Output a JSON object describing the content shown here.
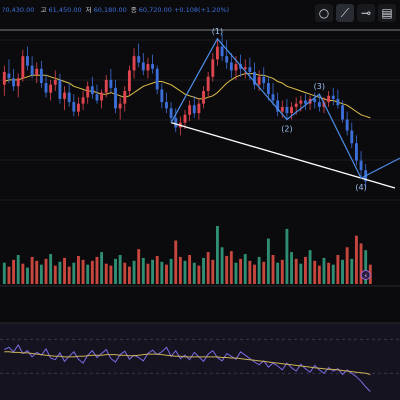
{
  "toolbar": {
    "items": [
      {
        "icon": "circle-tool-icon",
        "glyph": "○"
      },
      {
        "icon": "trendline-tool-icon",
        "glyph": "⟋"
      },
      {
        "icon": "horizontal-line-tool-icon",
        "glyph": "⊸"
      },
      {
        "icon": "more-tools-icon",
        "glyph": "▤"
      }
    ]
  },
  "chart_data": [
    {
      "type": "candlestick",
      "panel": "price",
      "header": {
        "left_text": "?0,430.00",
        "items": [
          {
            "key": "고",
            "value": "61,450.00"
          },
          {
            "key": "저",
            "value": "60,180.00"
          },
          {
            "key": "종",
            "value": "60,720.00 +0.108(+1.20%)"
          }
        ]
      },
      "up_color": "#e0464f",
      "down_color": "#3d6fd8",
      "candles": [
        {
          "o": 48,
          "h": 60,
          "l": 41,
          "c": 56
        },
        {
          "o": 55,
          "h": 64,
          "l": 49,
          "c": 52
        },
        {
          "o": 52,
          "h": 58,
          "l": 44,
          "c": 47
        },
        {
          "o": 47,
          "h": 55,
          "l": 40,
          "c": 52
        },
        {
          "o": 52,
          "h": 70,
          "l": 50,
          "c": 66
        },
        {
          "o": 66,
          "h": 72,
          "l": 57,
          "c": 60
        },
        {
          "o": 60,
          "h": 66,
          "l": 52,
          "c": 54
        },
        {
          "o": 54,
          "h": 62,
          "l": 49,
          "c": 58
        },
        {
          "o": 58,
          "h": 63,
          "l": 46,
          "c": 49
        },
        {
          "o": 49,
          "h": 54,
          "l": 40,
          "c": 43
        },
        {
          "o": 43,
          "h": 51,
          "l": 38,
          "c": 48
        },
        {
          "o": 48,
          "h": 57,
          "l": 44,
          "c": 51
        },
        {
          "o": 51,
          "h": 55,
          "l": 36,
          "c": 39
        },
        {
          "o": 39,
          "h": 47,
          "l": 32,
          "c": 43
        },
        {
          "o": 43,
          "h": 49,
          "l": 34,
          "c": 37
        },
        {
          "o": 37,
          "h": 42,
          "l": 28,
          "c": 31
        },
        {
          "o": 31,
          "h": 40,
          "l": 28,
          "c": 36
        },
        {
          "o": 36,
          "h": 44,
          "l": 32,
          "c": 40
        },
        {
          "o": 40,
          "h": 50,
          "l": 36,
          "c": 47
        },
        {
          "o": 47,
          "h": 53,
          "l": 39,
          "c": 42
        },
        {
          "o": 42,
          "h": 48,
          "l": 36,
          "c": 38
        },
        {
          "o": 38,
          "h": 45,
          "l": 33,
          "c": 43
        },
        {
          "o": 43,
          "h": 54,
          "l": 40,
          "c": 51
        },
        {
          "o": 51,
          "h": 58,
          "l": 43,
          "c": 46
        },
        {
          "o": 46,
          "h": 51,
          "l": 30,
          "c": 33
        },
        {
          "o": 33,
          "h": 40,
          "l": 26,
          "c": 36
        },
        {
          "o": 36,
          "h": 47,
          "l": 31,
          "c": 44
        },
        {
          "o": 44,
          "h": 60,
          "l": 41,
          "c": 57
        },
        {
          "o": 57,
          "h": 71,
          "l": 52,
          "c": 66
        },
        {
          "o": 66,
          "h": 74,
          "l": 59,
          "c": 62
        },
        {
          "o": 62,
          "h": 68,
          "l": 54,
          "c": 57
        },
        {
          "o": 57,
          "h": 65,
          "l": 52,
          "c": 61
        },
        {
          "o": 61,
          "h": 67,
          "l": 55,
          "c": 58
        },
        {
          "o": 58,
          "h": 60,
          "l": 42,
          "c": 45
        },
        {
          "o": 45,
          "h": 49,
          "l": 33,
          "c": 37
        },
        {
          "o": 37,
          "h": 43,
          "l": 30,
          "c": 33
        },
        {
          "o": 33,
          "h": 37,
          "l": 24,
          "c": 27
        },
        {
          "o": 27,
          "h": 33,
          "l": 18,
          "c": 21
        },
        {
          "o": 21,
          "h": 28,
          "l": 16,
          "c": 24
        },
        {
          "o": 24,
          "h": 32,
          "l": 20,
          "c": 29
        },
        {
          "o": 29,
          "h": 38,
          "l": 25,
          "c": 35
        },
        {
          "o": 35,
          "h": 41,
          "l": 27,
          "c": 30
        },
        {
          "o": 30,
          "h": 39,
          "l": 26,
          "c": 36
        },
        {
          "o": 36,
          "h": 47,
          "l": 33,
          "c": 44
        },
        {
          "o": 44,
          "h": 56,
          "l": 40,
          "c": 53
        },
        {
          "o": 53,
          "h": 68,
          "l": 50,
          "c": 64
        },
        {
          "o": 64,
          "h": 77,
          "l": 60,
          "c": 72
        },
        {
          "o": 72,
          "h": 80,
          "l": 63,
          "c": 66
        },
        {
          "o": 66,
          "h": 76,
          "l": 58,
          "c": 62
        },
        {
          "o": 62,
          "h": 68,
          "l": 52,
          "c": 57
        },
        {
          "o": 57,
          "h": 66,
          "l": 51,
          "c": 61
        },
        {
          "o": 61,
          "h": 67,
          "l": 53,
          "c": 58
        },
        {
          "o": 58,
          "h": 64,
          "l": 52,
          "c": 59
        },
        {
          "o": 59,
          "h": 65,
          "l": 51,
          "c": 56
        },
        {
          "o": 56,
          "h": 62,
          "l": 45,
          "c": 48
        },
        {
          "o": 48,
          "h": 57,
          "l": 44,
          "c": 53
        },
        {
          "o": 53,
          "h": 59,
          "l": 45,
          "c": 49
        },
        {
          "o": 49,
          "h": 53,
          "l": 38,
          "c": 42
        },
        {
          "o": 42,
          "h": 49,
          "l": 35,
          "c": 38
        },
        {
          "o": 38,
          "h": 43,
          "l": 28,
          "c": 31
        },
        {
          "o": 31,
          "h": 38,
          "l": 27,
          "c": 34
        },
        {
          "o": 34,
          "h": 39,
          "l": 26,
          "c": 30
        },
        {
          "o": 30,
          "h": 37,
          "l": 26,
          "c": 34
        },
        {
          "o": 34,
          "h": 40,
          "l": 29,
          "c": 36
        },
        {
          "o": 36,
          "h": 41,
          "l": 31,
          "c": 38
        },
        {
          "o": 38,
          "h": 42,
          "l": 32,
          "c": 36
        },
        {
          "o": 36,
          "h": 41,
          "l": 32,
          "c": 39
        },
        {
          "o": 39,
          "h": 43,
          "l": 33,
          "c": 37
        },
        {
          "o": 37,
          "h": 42,
          "l": 31,
          "c": 34
        },
        {
          "o": 34,
          "h": 40,
          "l": 30,
          "c": 37
        },
        {
          "o": 37,
          "h": 44,
          "l": 34,
          "c": 41
        },
        {
          "o": 41,
          "h": 46,
          "l": 35,
          "c": 39
        },
        {
          "o": 39,
          "h": 45,
          "l": 33,
          "c": 35
        },
        {
          "o": 35,
          "h": 38,
          "l": 24,
          "c": 26
        },
        {
          "o": 26,
          "h": 31,
          "l": 16,
          "c": 19
        },
        {
          "o": 19,
          "h": 24,
          "l": 8,
          "c": 11
        },
        {
          "o": 11,
          "h": 16,
          "l": -3,
          "c": 0
        },
        {
          "o": 0,
          "h": 6,
          "l": -11,
          "c": -6
        },
        {
          "o": -6,
          "h": -2,
          "l": -16,
          "c": -13
        }
      ],
      "moving_average": [
        50,
        51,
        51,
        51,
        52,
        53,
        54,
        54,
        54,
        54,
        53,
        52,
        51,
        50,
        49,
        47,
        46,
        45,
        44,
        44,
        43,
        42,
        42,
        43,
        42,
        41,
        40,
        41,
        43,
        45,
        47,
        48,
        49,
        50,
        50,
        49,
        48,
        46,
        44,
        42,
        41,
        40,
        39,
        39,
        40,
        41,
        43,
        46,
        49,
        51,
        53,
        54,
        55,
        55,
        55,
        54,
        54,
        53,
        52,
        50,
        49,
        47,
        46,
        45,
        44,
        43,
        42,
        41,
        40,
        39,
        38,
        38,
        37,
        36,
        35,
        33,
        31,
        29,
        28,
        27
      ],
      "ma_color": "#e2c14a",
      "wave_labels": [
        {
          "label": "(1)",
          "index": 46
        },
        {
          "label": "(2)",
          "index": 61
        },
        {
          "label": "(3)",
          "index": 68
        },
        {
          "label": "(4)",
          "index": 77
        }
      ],
      "wave_color": "#4d8ee8",
      "trendline_color": "#ffffff"
    },
    {
      "type": "bar",
      "panel": "volume",
      "values": [
        22,
        18,
        25,
        30,
        21,
        17,
        28,
        24,
        20,
        26,
        31,
        19,
        23,
        27,
        18,
        22,
        29,
        25,
        20,
        24,
        28,
        33,
        21,
        19,
        26,
        30,
        22,
        18,
        24,
        36,
        27,
        21,
        25,
        29,
        23,
        20,
        26,
        45,
        28,
        24,
        30,
        22,
        19,
        27,
        33,
        25,
        60,
        38,
        29,
        34,
        22,
        26,
        31,
        24,
        20,
        28,
        23,
        47,
        30,
        22,
        25,
        57,
        33,
        26,
        21,
        28,
        35,
        24,
        19,
        27,
        22,
        20,
        30,
        25,
        38,
        26,
        50,
        42,
        35,
        20
      ],
      "bar_colors": [
        "down",
        "up",
        "up",
        "down",
        "up",
        "down",
        "up",
        "up",
        "down",
        "up",
        "down",
        "up",
        "down",
        "up",
        "up",
        "down",
        "up",
        "up",
        "down",
        "up",
        "up",
        "down",
        "up",
        "up",
        "down",
        "down",
        "up",
        "up",
        "down",
        "up",
        "down",
        "up",
        "down",
        "up",
        "down",
        "up",
        "down",
        "up",
        "up",
        "down",
        "up",
        "down",
        "up",
        "down",
        "up",
        "up",
        "down",
        "down",
        "up",
        "up",
        "down",
        "up",
        "down",
        "up",
        "up",
        "down",
        "up",
        "down",
        "up",
        "down",
        "up",
        "down",
        "down",
        "up",
        "down",
        "up",
        "down",
        "up",
        "up",
        "down",
        "up",
        "down",
        "up",
        "down",
        "up",
        "down",
        "up",
        "up",
        "down",
        "up"
      ],
      "up_color": "#c7473f",
      "down_color": "#2f8f74",
      "marker_glyph": "⚡"
    },
    {
      "type": "line",
      "panel": "oscillator",
      "series": [
        {
          "color": "#7a6ce6",
          "values": [
            62,
            66,
            58,
            70,
            55,
            60,
            49,
            57,
            52,
            63,
            47,
            44,
            56,
            41,
            50,
            58,
            45,
            38,
            52,
            60,
            48,
            55,
            62,
            46,
            40,
            53,
            59,
            45,
            52,
            48,
            42,
            55,
            61,
            53,
            58,
            66,
            50,
            60,
            46,
            52,
            44,
            57,
            49,
            41,
            54,
            60,
            48,
            42,
            55,
            50,
            45,
            58,
            52,
            46,
            40,
            35,
            42,
            31,
            38,
            33,
            26,
            38,
            30,
            24,
            36,
            28,
            22,
            34,
            26,
            20,
            30,
            24,
            28,
            18,
            26,
            20,
            14,
            6,
            -4,
            -12
          ]
        },
        {
          "color": "#c9b25a",
          "values": [
            58,
            58,
            57,
            57,
            56,
            56,
            55,
            54,
            53,
            52,
            51,
            50,
            50,
            49,
            49,
            49,
            50,
            50,
            51,
            52,
            52,
            52,
            53,
            53,
            53,
            52,
            52,
            51,
            51,
            52,
            53,
            54,
            54,
            54,
            53,
            52,
            51,
            50,
            50,
            49,
            49,
            49,
            49,
            49,
            49,
            49,
            49,
            48,
            48,
            47,
            47,
            46,
            45,
            44,
            43,
            42,
            41,
            40,
            39,
            38,
            37,
            36,
            35,
            34,
            33,
            32,
            31,
            30,
            29,
            28,
            27,
            27,
            26,
            25,
            24,
            23,
            22,
            21,
            20,
            18
          ]
        }
      ],
      "guide_lines": [
        80,
        20
      ]
    }
  ]
}
